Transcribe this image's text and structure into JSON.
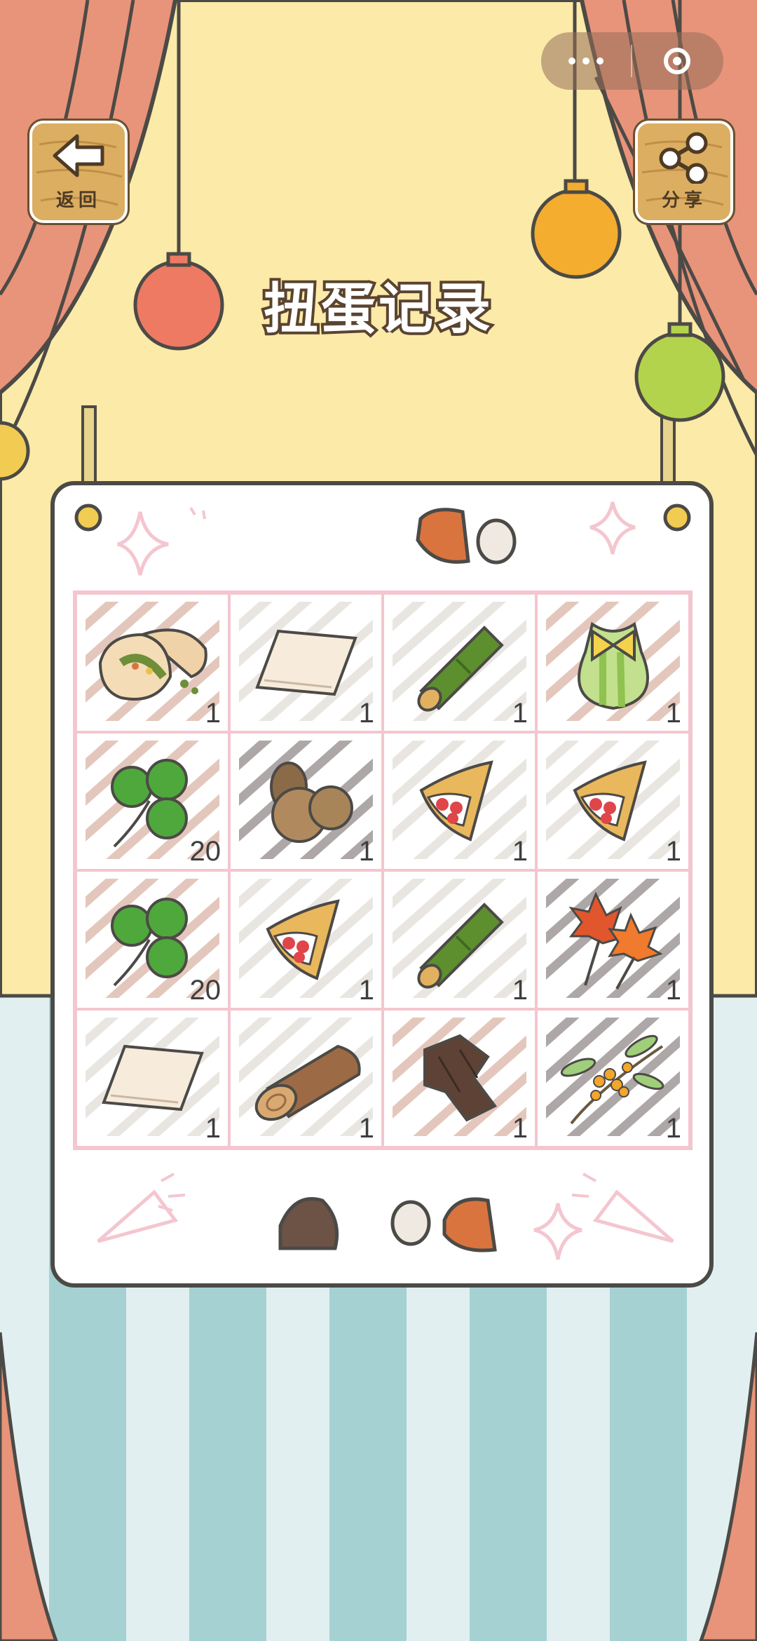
{
  "screen": {
    "title": "扭蛋记录",
    "back_button": {
      "label": "返回",
      "icon": "arrow-left-icon"
    },
    "share_button": {
      "label": "分享",
      "icon": "share-icon"
    },
    "capsule": {
      "more_icon": "more-dots-icon",
      "close_icon": "target-close-icon"
    }
  },
  "colors": {
    "curtain": "#e8947a",
    "backdrop": "#fbeaa8",
    "floor_stripe_a": "#a6d1d3",
    "floor_stripe_b": "#e1eff0",
    "grid_line": "#f4c6cf",
    "outline": "#4c4a46"
  },
  "records": [
    {
      "item": "bread-icon",
      "qty": "1",
      "hatch": "#cf9b86"
    },
    {
      "item": "paper-sheet-icon",
      "qty": "1",
      "hatch": "#d8d2cc"
    },
    {
      "item": "bamboo-icon",
      "qty": "1",
      "hatch": "#d8d2cc"
    },
    {
      "item": "gift-pouch-icon",
      "qty": "1",
      "hatch": "#cf9b86"
    },
    {
      "item": "clover-icon",
      "qty": "20",
      "hatch": "#cf9b86"
    },
    {
      "item": "nuts-icon",
      "qty": "1",
      "hatch": "#6b6260"
    },
    {
      "item": "crepe-icon",
      "qty": "1",
      "hatch": "#d8d2cc"
    },
    {
      "item": "crepe-icon",
      "qty": "1",
      "hatch": "#d8d2cc"
    },
    {
      "item": "clover-icon",
      "qty": "20",
      "hatch": "#cf9b86"
    },
    {
      "item": "crepe-icon",
      "qty": "1",
      "hatch": "#d8d2cc"
    },
    {
      "item": "bamboo-icon",
      "qty": "1",
      "hatch": "#d8d2cc"
    },
    {
      "item": "maple-leaf-icon",
      "qty": "1",
      "hatch": "#6b6260"
    },
    {
      "item": "paper-sheet-icon",
      "qty": "1",
      "hatch": "#d8d2cc"
    },
    {
      "item": "wood-log-icon",
      "qty": "1",
      "hatch": "#d8d2cc"
    },
    {
      "item": "bark-icon",
      "qty": "1",
      "hatch": "#cf9b86"
    },
    {
      "item": "osmanthus-icon",
      "qty": "1",
      "hatch": "#6b6260"
    }
  ]
}
